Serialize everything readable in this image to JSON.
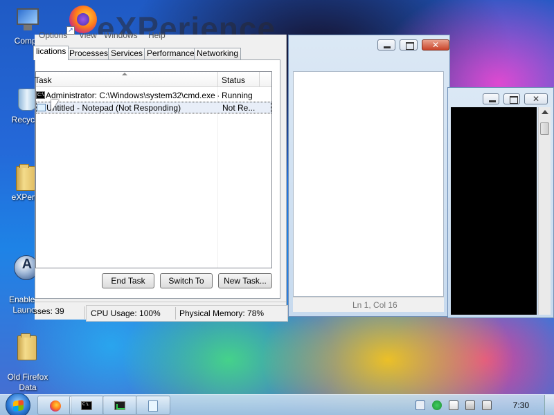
{
  "desktop": {
    "watermark": "eXPerience",
    "icons": [
      {
        "label": "Compu"
      },
      {
        "label": "Recycle"
      },
      {
        "label": "eXPerie"
      },
      {
        "label": "Enable Q\nLaunch"
      },
      {
        "label": "Old Firefox\nData"
      }
    ]
  },
  "taskmgr": {
    "menu": [
      "Options",
      "View",
      "Windows",
      "Help"
    ],
    "tabs": [
      "lications",
      "Processes",
      "Services",
      "Performance",
      "Networking"
    ],
    "columns": {
      "task": "Task",
      "status": "Status"
    },
    "rows": [
      {
        "task": "Administrator: C:\\Windows\\system32\\cmd.exe -...",
        "status": "Running"
      },
      {
        "task": "Untitled - Notepad (Not Responding)",
        "status": "Not Re..."
      }
    ],
    "buttons": {
      "end_task": "End Task",
      "switch_to": "Switch To",
      "new_task": "New Task..."
    },
    "status": {
      "processes": "sses: 39",
      "cpu": "CPU Usage: 100%",
      "memory": "Physical Memory: 78%"
    }
  },
  "notepad": {
    "status_position": "Ln 1, Col 16"
  },
  "taskbar": {
    "clock": "7:30",
    "cmd_icon_text": "C:\\."
  },
  "colors": {
    "selection": "#e8eef8",
    "close_button": "#c9442a",
    "cpu_graph": "#2fd14f"
  }
}
